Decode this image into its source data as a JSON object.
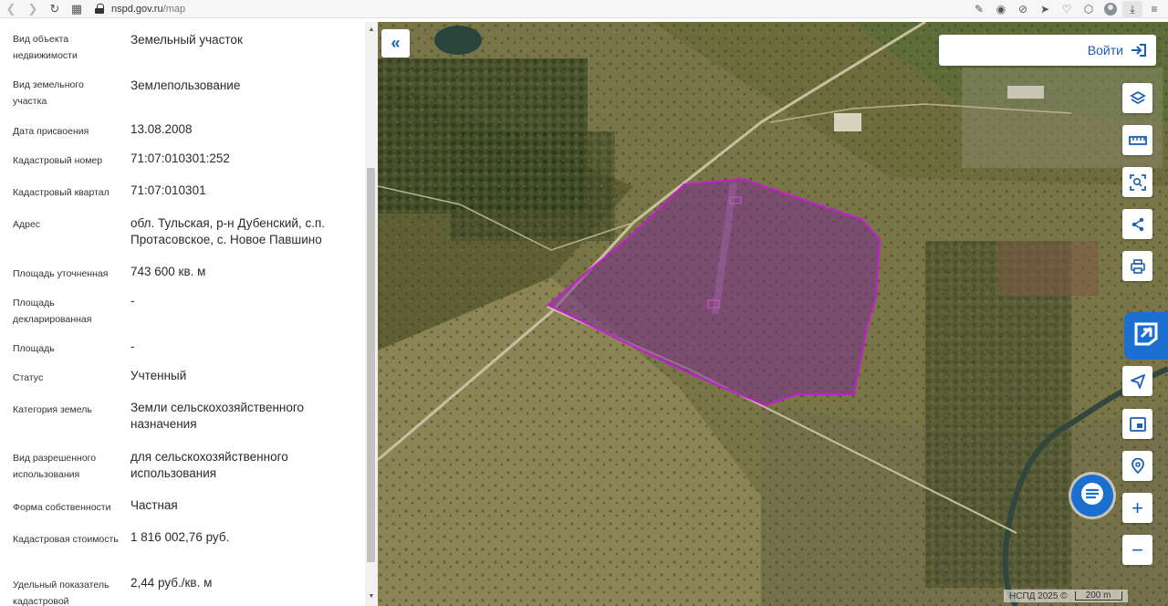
{
  "browser": {
    "url_host": "nspd.gov.ru",
    "url_path": "/map"
  },
  "properties": [
    {
      "label": "Вид объекта недвижимости",
      "value": "Земельный участок"
    },
    {
      "label": "Вид земельного участка",
      "value": "Землепользование"
    },
    {
      "label": "Дата присвоения",
      "value": "13.08.2008"
    },
    {
      "label": "Кадастровый номер",
      "value": "71:07:010301:252"
    },
    {
      "label": "Кадастровый квартал",
      "value": "71:07:010301"
    },
    {
      "label": "Адрес",
      "value": "обл. Тульская, р-н Дубенский, с.п. Протасовское, с. Новое Павшино"
    },
    {
      "label": "Площадь уточненная",
      "value": "743 600 кв. м"
    },
    {
      "label": "Площадь декларированная",
      "value": "-"
    },
    {
      "label": "Площадь",
      "value": "-"
    },
    {
      "label": "Статус",
      "value": "Учтенный"
    },
    {
      "label": "Категория земель",
      "value": "Земли сельскохозяйственного назначения"
    },
    {
      "label": "Вид разрешенного использования",
      "value": "для сельскохозяйственного использования"
    },
    {
      "label": "Форма собственности",
      "value": "Частная"
    },
    {
      "label": "Кадастровая стоимость",
      "value": "1 816 002,76 руб."
    },
    {
      "label": "Удельный показатель кадастровой",
      "value": "2,44 руб./кв. м"
    }
  ],
  "map": {
    "login_label": "Войти",
    "attribution": "НСПД 2025 ©",
    "scale_label": "200 m",
    "zoom_in": "+",
    "zoom_out": "−",
    "collapse_glyph": "«",
    "parcel_color": "#c21fd0",
    "accent_color": "#1b6fd1"
  }
}
